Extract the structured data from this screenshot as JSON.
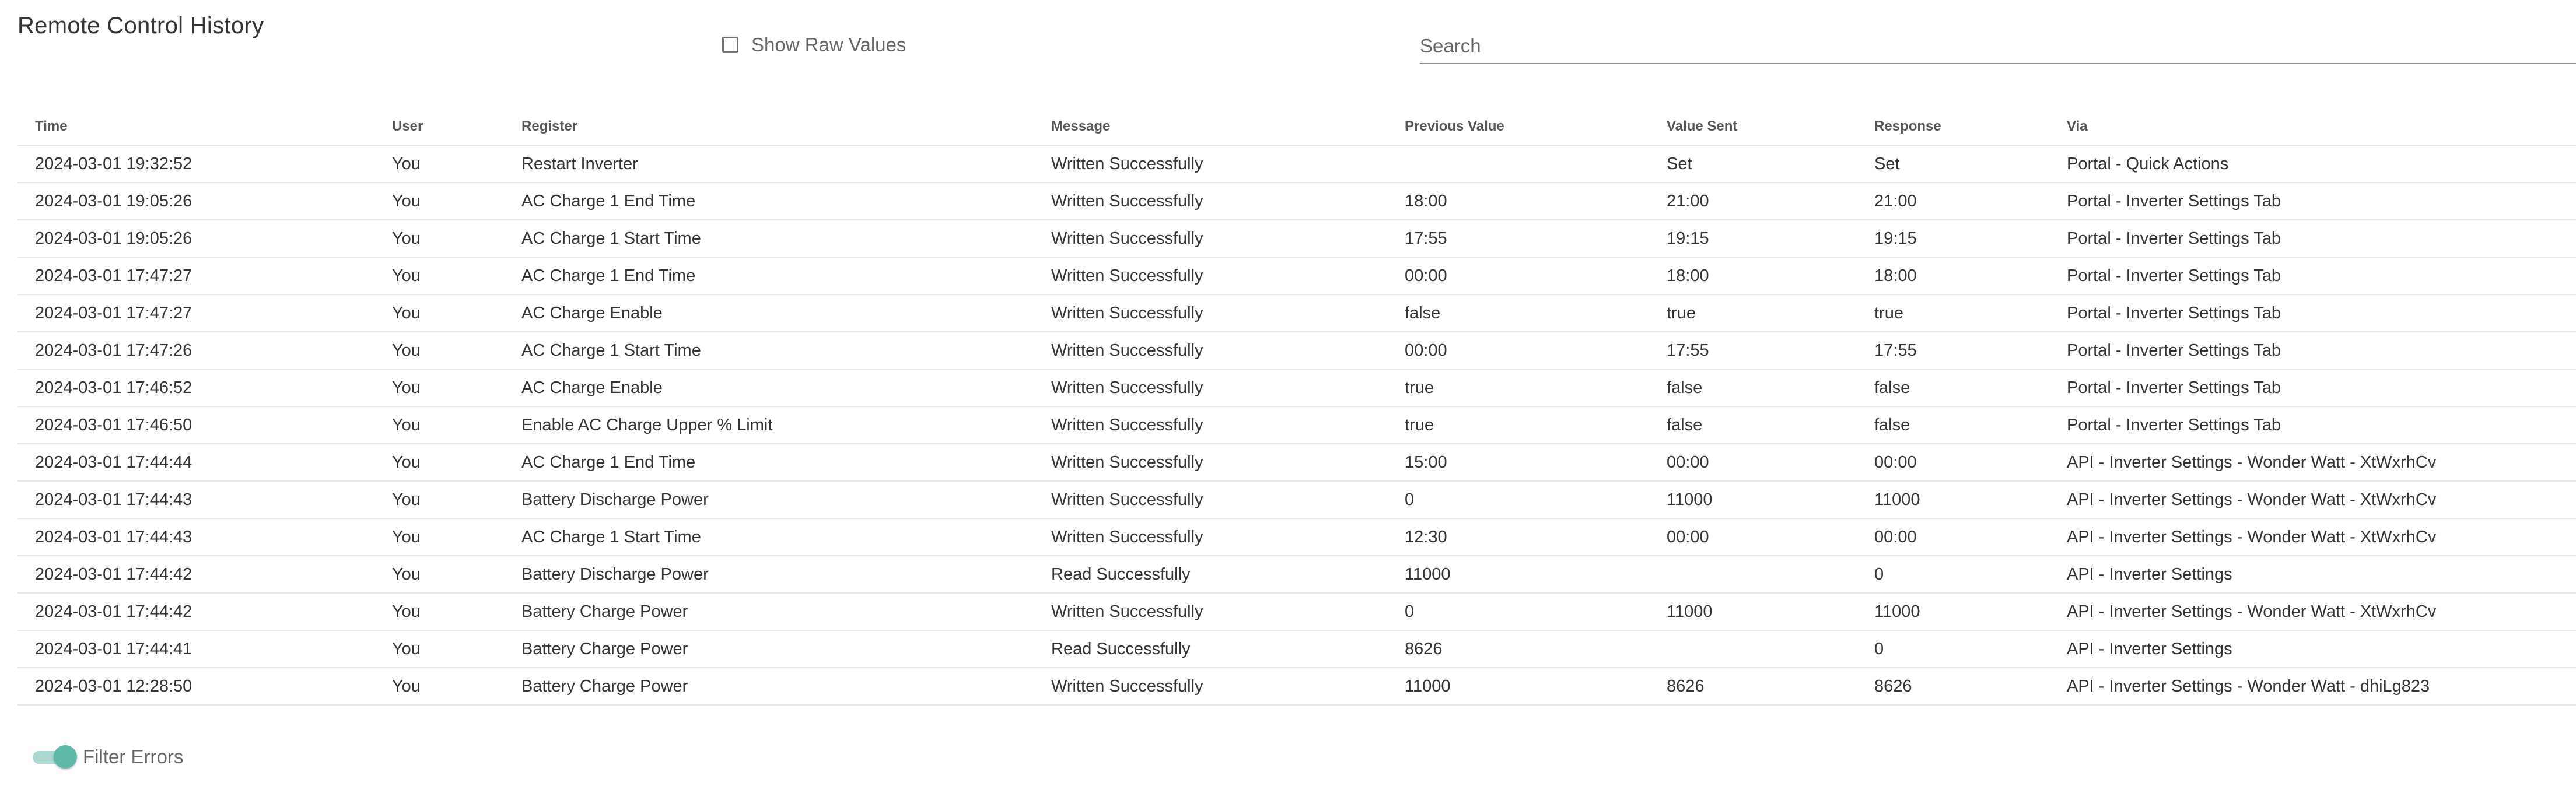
{
  "page": {
    "title": "Remote Control History",
    "show_raw_values_label": "Show Raw Values",
    "search_placeholder": "Search",
    "filter_errors_label": "Filter Errors"
  },
  "colors": {
    "accent": "#5fb9ab",
    "accent_light": "#a8d8d0",
    "text": "#333333",
    "muted": "#666666",
    "divider": "#e6e6e6"
  },
  "table": {
    "columns": [
      "Time",
      "User",
      "Register",
      "Message",
      "Previous Value",
      "Value Sent",
      "Response",
      "Via"
    ],
    "rows": [
      [
        "2024-03-01 19:32:52",
        "You",
        "Restart Inverter",
        "Written Successfully",
        "",
        "Set",
        "Set",
        "Portal - Quick Actions"
      ],
      [
        "2024-03-01 19:05:26",
        "You",
        "AC Charge 1 End Time",
        "Written Successfully",
        "18:00",
        "21:00",
        "21:00",
        "Portal - Inverter Settings Tab"
      ],
      [
        "2024-03-01 19:05:26",
        "You",
        "AC Charge 1 Start Time",
        "Written Successfully",
        "17:55",
        "19:15",
        "19:15",
        "Portal - Inverter Settings Tab"
      ],
      [
        "2024-03-01 17:47:27",
        "You",
        "AC Charge 1 End Time",
        "Written Successfully",
        "00:00",
        "18:00",
        "18:00",
        "Portal - Inverter Settings Tab"
      ],
      [
        "2024-03-01 17:47:27",
        "You",
        "AC Charge Enable",
        "Written Successfully",
        "false",
        "true",
        "true",
        "Portal - Inverter Settings Tab"
      ],
      [
        "2024-03-01 17:47:26",
        "You",
        "AC Charge 1 Start Time",
        "Written Successfully",
        "00:00",
        "17:55",
        "17:55",
        "Portal - Inverter Settings Tab"
      ],
      [
        "2024-03-01 17:46:52",
        "You",
        "AC Charge Enable",
        "Written Successfully",
        "true",
        "false",
        "false",
        "Portal - Inverter Settings Tab"
      ],
      [
        "2024-03-01 17:46:50",
        "You",
        "Enable AC Charge Upper % Limit",
        "Written Successfully",
        "true",
        "false",
        "false",
        "Portal - Inverter Settings Tab"
      ],
      [
        "2024-03-01 17:44:44",
        "You",
        "AC Charge 1 End Time",
        "Written Successfully",
        "15:00",
        "00:00",
        "00:00",
        "API - Inverter Settings - Wonder Watt - XtWxrhCv"
      ],
      [
        "2024-03-01 17:44:43",
        "You",
        "Battery Discharge Power",
        "Written Successfully",
        "0",
        "11000",
        "11000",
        "API - Inverter Settings - Wonder Watt - XtWxrhCv"
      ],
      [
        "2024-03-01 17:44:43",
        "You",
        "AC Charge 1 Start Time",
        "Written Successfully",
        "12:30",
        "00:00",
        "00:00",
        "API - Inverter Settings - Wonder Watt - XtWxrhCv"
      ],
      [
        "2024-03-01 17:44:42",
        "You",
        "Battery Discharge Power",
        "Read Successfully",
        "11000",
        "",
        "0",
        "API - Inverter Settings"
      ],
      [
        "2024-03-01 17:44:42",
        "You",
        "Battery Charge Power",
        "Written Successfully",
        "0",
        "11000",
        "11000",
        "API - Inverter Settings - Wonder Watt - XtWxrhCv"
      ],
      [
        "2024-03-01 17:44:41",
        "You",
        "Battery Charge Power",
        "Read Successfully",
        "8626",
        "",
        "0",
        "API - Inverter Settings"
      ],
      [
        "2024-03-01 12:28:50",
        "You",
        "Battery Charge Power",
        "Written Successfully",
        "11000",
        "8626",
        "8626",
        "API - Inverter Settings - Wonder Watt - dhiLg823"
      ]
    ]
  }
}
